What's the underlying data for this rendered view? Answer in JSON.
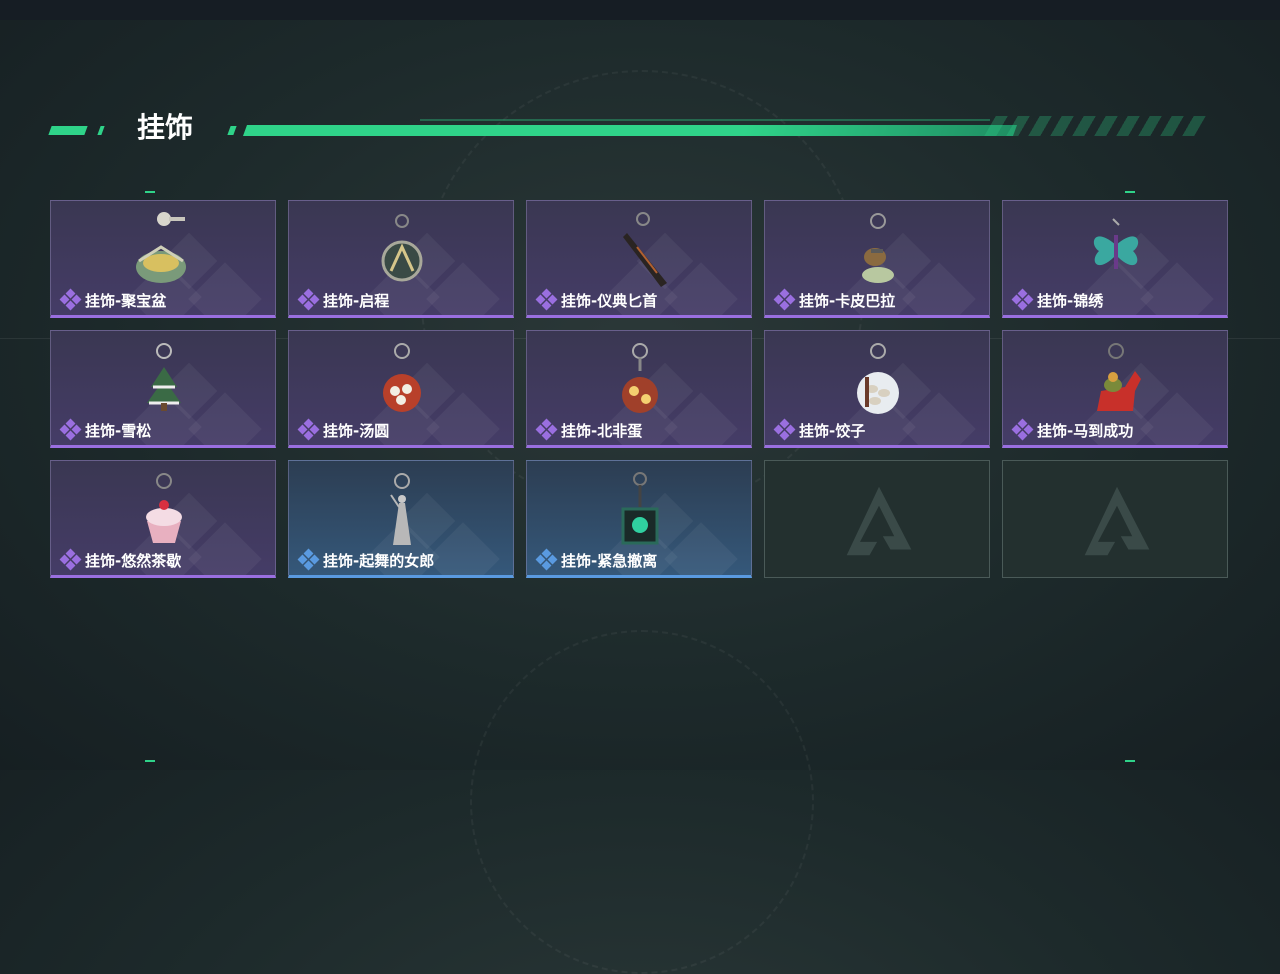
{
  "section": {
    "title": "挂饰"
  },
  "items": [
    {
      "label": "挂饰-聚宝盆",
      "rarity": "purple",
      "icon": "treasure-bowl-charm-icon"
    },
    {
      "label": "挂饰-启程",
      "rarity": "purple",
      "icon": "compass-medal-charm-icon"
    },
    {
      "label": "挂饰-仪典匕首",
      "rarity": "purple",
      "icon": "ceremonial-dagger-charm-icon"
    },
    {
      "label": "挂饰-卡皮巴拉",
      "rarity": "purple",
      "icon": "capybara-charm-icon"
    },
    {
      "label": "挂饰-锦绣",
      "rarity": "purple",
      "icon": "butterfly-charm-icon"
    },
    {
      "label": "挂饰-雪松",
      "rarity": "purple",
      "icon": "snowy-pine-charm-icon"
    },
    {
      "label": "挂饰-汤圆",
      "rarity": "purple",
      "icon": "rice-ball-bowl-charm-icon"
    },
    {
      "label": "挂饰-北非蛋",
      "rarity": "purple",
      "icon": "shakshuka-pan-charm-icon"
    },
    {
      "label": "挂饰-饺子",
      "rarity": "purple",
      "icon": "dumpling-plate-charm-icon"
    },
    {
      "label": "挂饰-马到成功",
      "rarity": "purple",
      "icon": "red-horse-charm-icon"
    },
    {
      "label": "挂饰-悠然茶歇",
      "rarity": "purple",
      "icon": "cupcake-charm-icon"
    },
    {
      "label": "挂饰-起舞的女郎",
      "rarity": "blue",
      "icon": "dancing-lady-charm-icon"
    },
    {
      "label": "挂饰-紧急撤离",
      "rarity": "blue",
      "icon": "emergency-evac-charm-icon"
    },
    {
      "label": "",
      "rarity": "empty",
      "icon": "empty-slot-logo-icon"
    },
    {
      "label": "",
      "rarity": "empty",
      "icon": "empty-slot-logo-icon"
    }
  ],
  "colors": {
    "accent": "#2fd389",
    "purple": "#9a6fe0",
    "blue": "#5a9ae0"
  }
}
